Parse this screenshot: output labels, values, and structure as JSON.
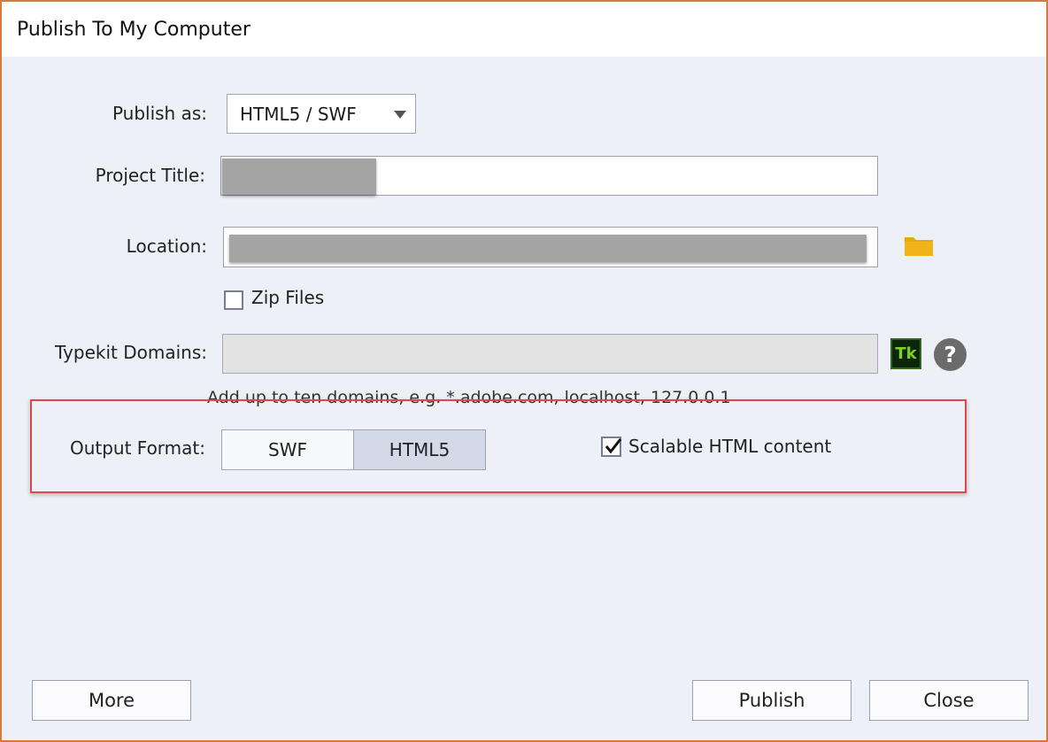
{
  "window": {
    "title": "Publish To My Computer"
  },
  "publish_as": {
    "label": "Publish as:",
    "value": "HTML5 / SWF"
  },
  "project_title": {
    "label": "Project Title:",
    "value": ""
  },
  "location": {
    "label": "Location:",
    "value": ""
  },
  "zip_files": {
    "label": "Zip Files",
    "checked": false
  },
  "typekit": {
    "label": "Typekit Domains:",
    "value": "",
    "tk_label": "Tk",
    "help_label": "?",
    "hint": "Add up to ten domains, e.g. *.adobe.com, localhost, 127.0.0.1"
  },
  "output_format": {
    "label": "Output Format:",
    "options": [
      "SWF",
      "HTML5"
    ],
    "selected": "HTML5"
  },
  "scalable": {
    "label": "Scalable HTML content",
    "checked": true
  },
  "buttons": {
    "more": "More",
    "publish": "Publish",
    "close": "Close"
  },
  "colors": {
    "window_border": "#d87a3a",
    "highlight": "#e04848",
    "folder": "#e8a90e"
  }
}
